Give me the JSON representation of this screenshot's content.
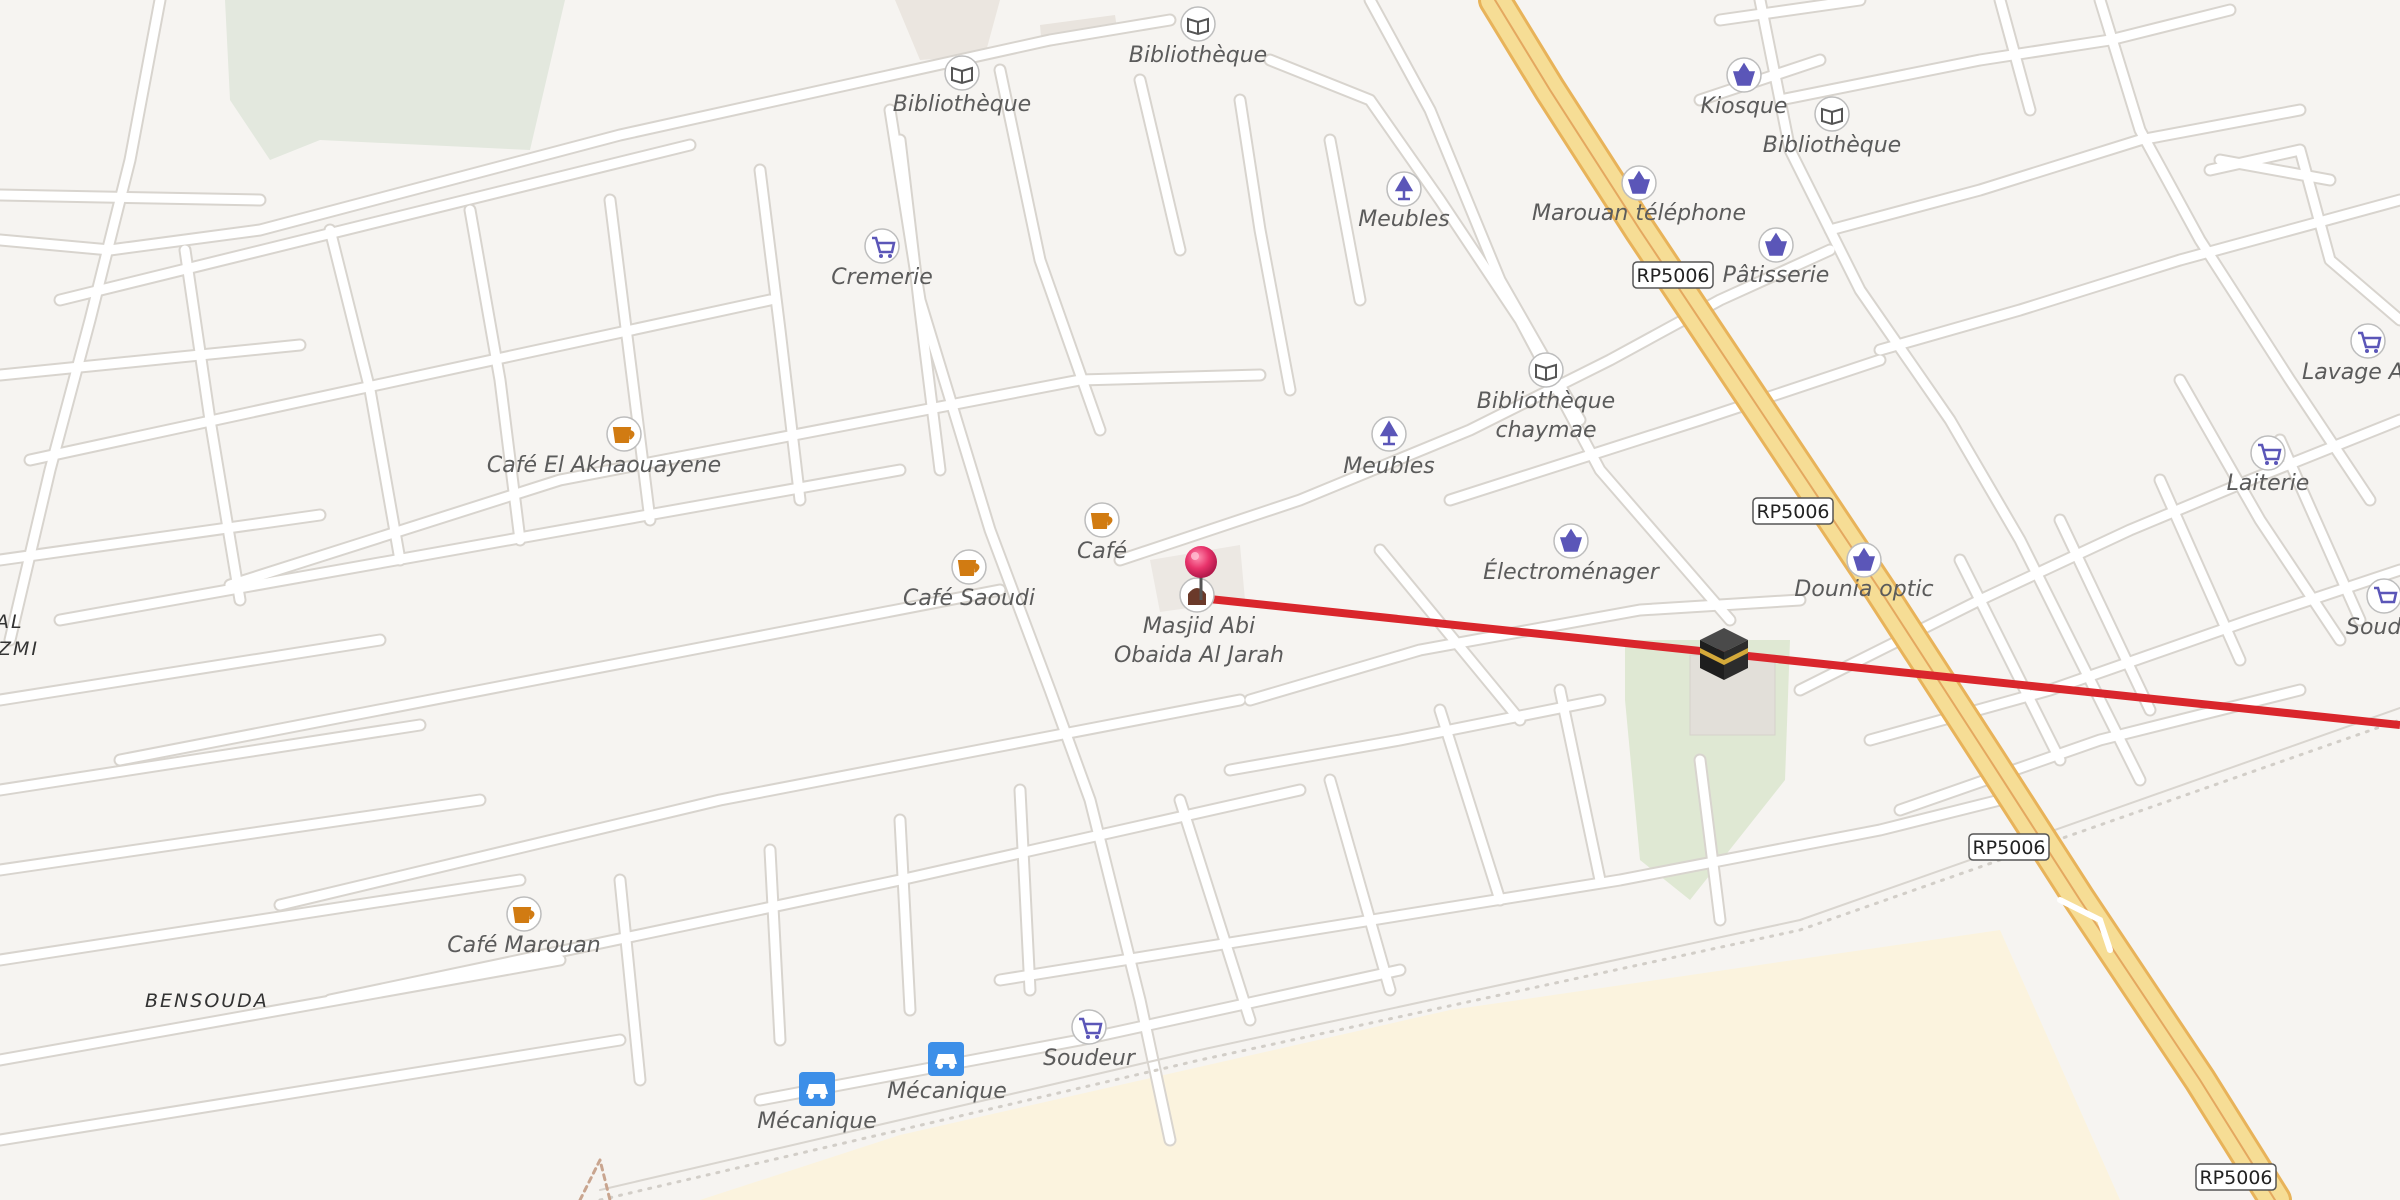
{
  "map": {
    "road_shields": [
      "RP5006",
      "RP5006",
      "RP5006",
      "RP5006"
    ],
    "pois": [
      {
        "label": "Bibliothèque",
        "icon": "book-icon"
      },
      {
        "label": "Bibliothèque",
        "icon": "book-icon"
      },
      {
        "label": "Kiosque",
        "icon": "basket-icon"
      },
      {
        "label": "Bibliothèque",
        "icon": "book-icon"
      },
      {
        "label": "Marouan téléphone",
        "icon": "basket-icon"
      },
      {
        "label": "Pâtisserie",
        "icon": "basket-icon"
      },
      {
        "label": "Meubles",
        "icon": "lamp-icon"
      },
      {
        "label": "Cremerie",
        "icon": "cart-icon"
      },
      {
        "label": "Lavage Au",
        "icon": "cart-icon"
      },
      {
        "label": "Bibliothèque",
        "line2": "chaymae",
        "icon": "book-icon"
      },
      {
        "label": "Café El Akhaouayene",
        "icon": "coffee-icon"
      },
      {
        "label": "Meubles",
        "icon": "lamp-icon"
      },
      {
        "label": "Laiterie",
        "icon": "cart-icon"
      },
      {
        "label": "Café",
        "icon": "coffee-icon"
      },
      {
        "label": "Électroménager",
        "icon": "basket-icon"
      },
      {
        "label": "Dounia optic",
        "icon": "basket-icon"
      },
      {
        "label": "Café Saoudi",
        "icon": "coffee-icon"
      },
      {
        "label": "Masjid Abi",
        "line2": "Obaida Al Jarah",
        "icon": "mosque-icon"
      },
      {
        "label": "Soude",
        "icon": "cart-icon"
      },
      {
        "label": "Café Marouan",
        "icon": "coffee-icon"
      },
      {
        "label": "Soudeur",
        "icon": "cart-icon"
      },
      {
        "label": "Mécanique",
        "icon": "car-icon"
      },
      {
        "label": "Mécanique",
        "icon": "car-icon"
      }
    ],
    "districts": [
      "BENSOUDA",
      "AL",
      "ZMI"
    ],
    "line_color": "#d9262c",
    "pin_color": "#e8336b"
  }
}
